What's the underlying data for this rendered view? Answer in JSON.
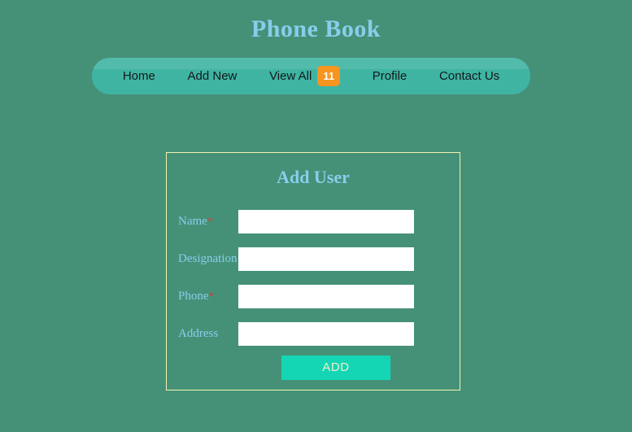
{
  "page": {
    "title": "Phone Book",
    "background_color": "#459178",
    "accent_color": "#87CEEB"
  },
  "nav": {
    "background_color": "#3FB4A3",
    "badge_color": "#F89420",
    "items": [
      {
        "label": "Home",
        "badge": null
      },
      {
        "label": "Add New",
        "badge": null
      },
      {
        "label": "View All",
        "badge": "11"
      },
      {
        "label": "Profile",
        "badge": null
      },
      {
        "label": "Contact Us",
        "badge": null
      }
    ]
  },
  "card": {
    "title": "Add User",
    "border_color": "#F2F2B0",
    "fields": [
      {
        "label": "Name",
        "required_marker": "*",
        "value": "",
        "placeholder": ""
      },
      {
        "label": "Designation",
        "required_marker": "",
        "value": "",
        "placeholder": ""
      },
      {
        "label": "Phone",
        "required_marker": "*",
        "value": "",
        "placeholder": ""
      },
      {
        "label": "Address",
        "required_marker": "",
        "value": "",
        "placeholder": ""
      }
    ],
    "submit": {
      "label": "ADD",
      "background_color": "#14D6B4",
      "text_color": "#EFEFC9"
    }
  }
}
